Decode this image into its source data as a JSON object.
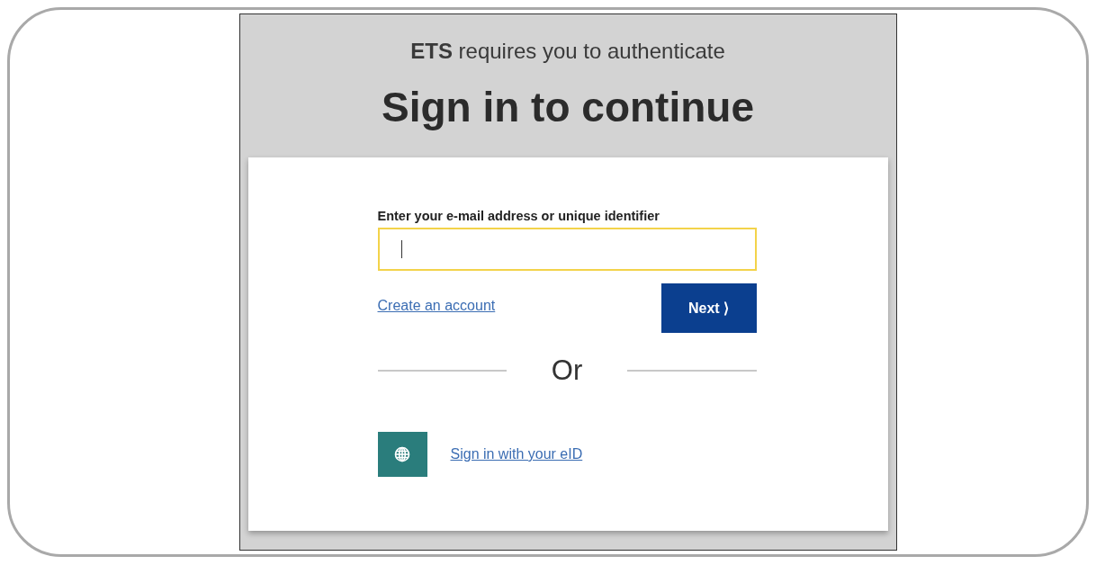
{
  "header": {
    "subtitle": "**ETS** requires you to authenticate",
    "title": "Sign in to continue"
  },
  "form": {
    "label": "Enter your e-mail address or unique identifier",
    "field_focused": true,
    "create_account_link": "Create an account",
    "next_button": "Next ⟩",
    "divider_text": "Or",
    "eid_link": "Sign in with your eID"
  }
}
